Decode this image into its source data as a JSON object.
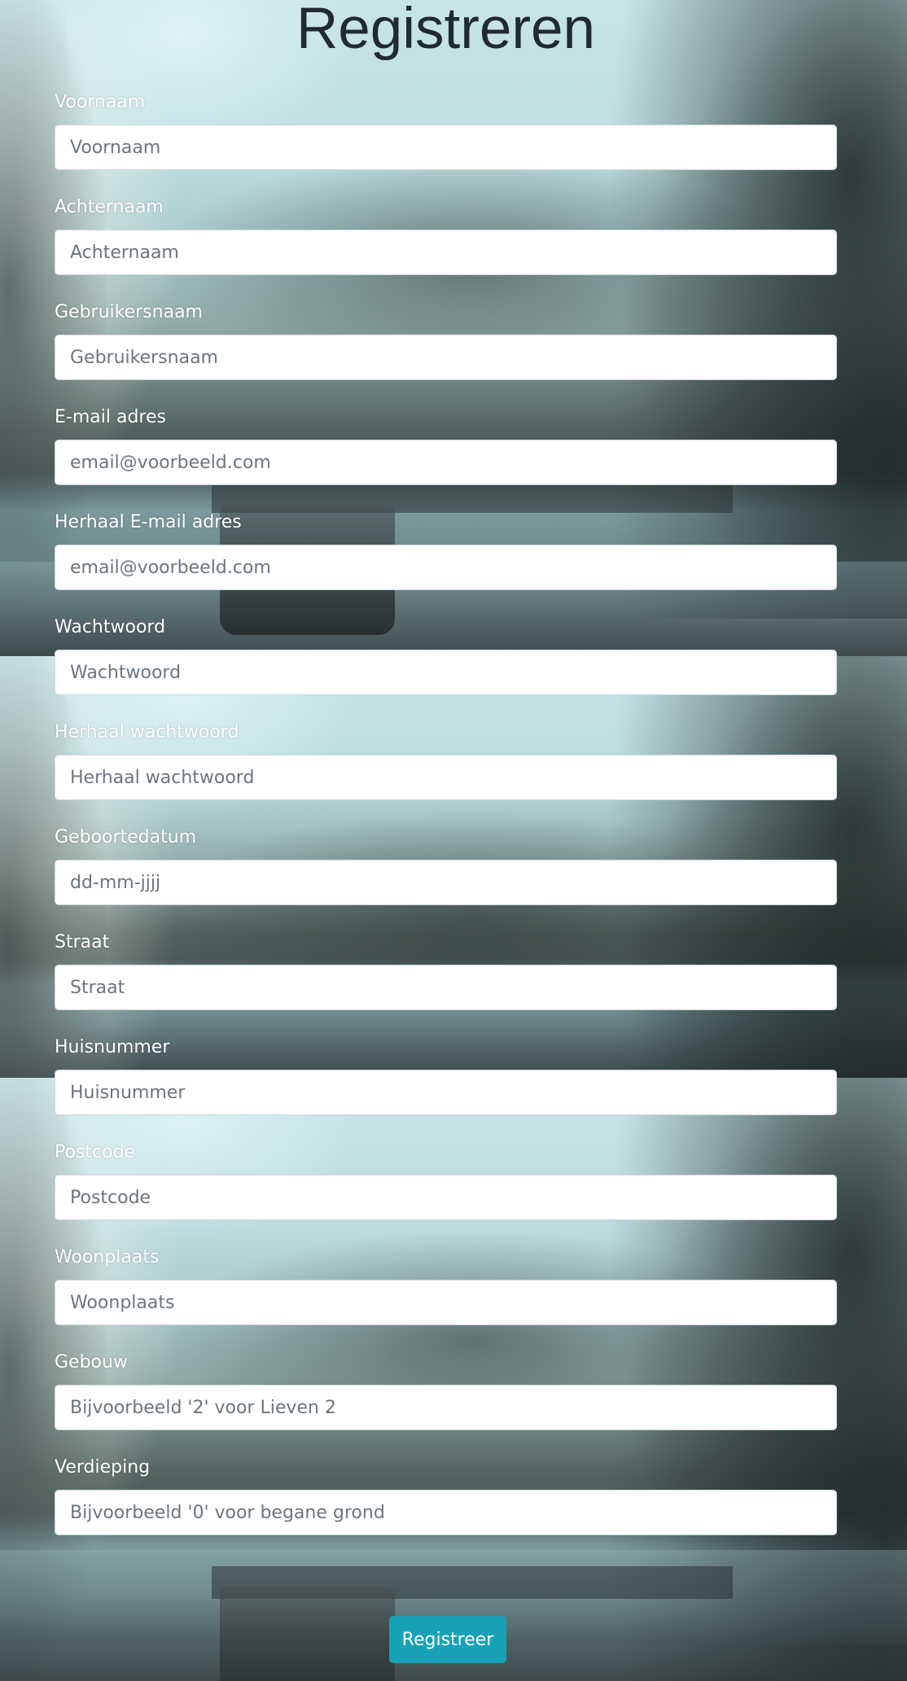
{
  "page": {
    "title": "Registreren"
  },
  "form": {
    "fields": [
      {
        "label": "Voornaam",
        "placeholder": "Voornaam",
        "type": "text"
      },
      {
        "label": "Achternaam",
        "placeholder": "Achternaam",
        "type": "text"
      },
      {
        "label": "Gebruikersnaam",
        "placeholder": "Gebruikersnaam",
        "type": "text"
      },
      {
        "label": "E-mail adres",
        "placeholder": "email@voorbeeld.com",
        "type": "email"
      },
      {
        "label": "Herhaal E-mail adres",
        "placeholder": "email@voorbeeld.com",
        "type": "email"
      },
      {
        "label": "Wachtwoord",
        "placeholder": "Wachtwoord",
        "type": "password"
      },
      {
        "label": "Herhaal wachtwoord",
        "placeholder": "Herhaal wachtwoord",
        "type": "password"
      },
      {
        "label": "Geboortedatum",
        "placeholder": "dd-mm-jjjj",
        "type": "date"
      },
      {
        "label": "Straat",
        "placeholder": "Straat",
        "type": "text"
      },
      {
        "label": "Huisnummer",
        "placeholder": "Huisnummer",
        "type": "text"
      },
      {
        "label": "Postcode",
        "placeholder": "Postcode",
        "type": "text"
      },
      {
        "label": "Woonplaats",
        "placeholder": "Woonplaats",
        "type": "text"
      },
      {
        "label": "Gebouw",
        "placeholder": "Bijvoorbeeld '2' voor Lieven 2",
        "type": "text"
      },
      {
        "label": "Verdieping",
        "placeholder": "Bijvoorbeeld '0' voor begane grond",
        "type": "text"
      }
    ],
    "submit_label": "Registreer"
  },
  "colors": {
    "submit_button": "#17a2b8",
    "label_text": "#ffffff",
    "title_text": "#1f2b2e"
  }
}
